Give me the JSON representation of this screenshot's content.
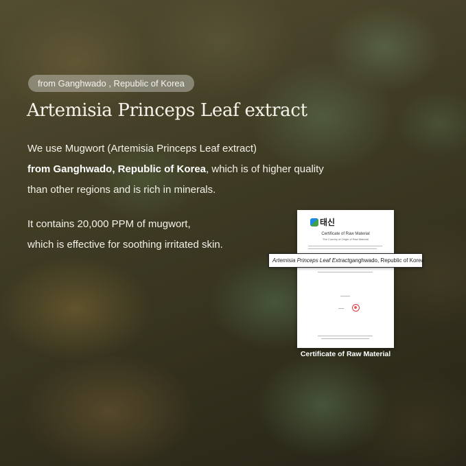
{
  "origin_tag": "from Ganghwado , Republic of Korea",
  "title": "Artemisia Princeps Leaf extract",
  "paragraph1": {
    "line1": "We use Mugwort (Artemisia Princeps Leaf extract)",
    "line2_bold": "from Ganghwado, Republic of Korea",
    "line2_rest": ", which is of higher quality",
    "line3": "than other regions and is rich in minerals."
  },
  "paragraph2": {
    "line1": "It contains 20,000 PPM of mugwort,",
    "line2": "which is effective for soothing irritated skin."
  },
  "certificate": {
    "logo_text": "태신",
    "title": "Certificate of Raw Material",
    "subtitle": "The Country of Origin of Raw Material",
    "band_left": "Artemisia Princeps Leaf Extract",
    "band_right": "ganghwado, Republic of Korea",
    "caption": "Certificate of Raw Material"
  },
  "colors": {
    "text": "#f2f1ea",
    "tag_bg": "#b9b9af",
    "seal": "#d9383a"
  },
  "icons": {
    "logo": "taeshin-logo-icon",
    "seal": "red-seal-icon"
  }
}
